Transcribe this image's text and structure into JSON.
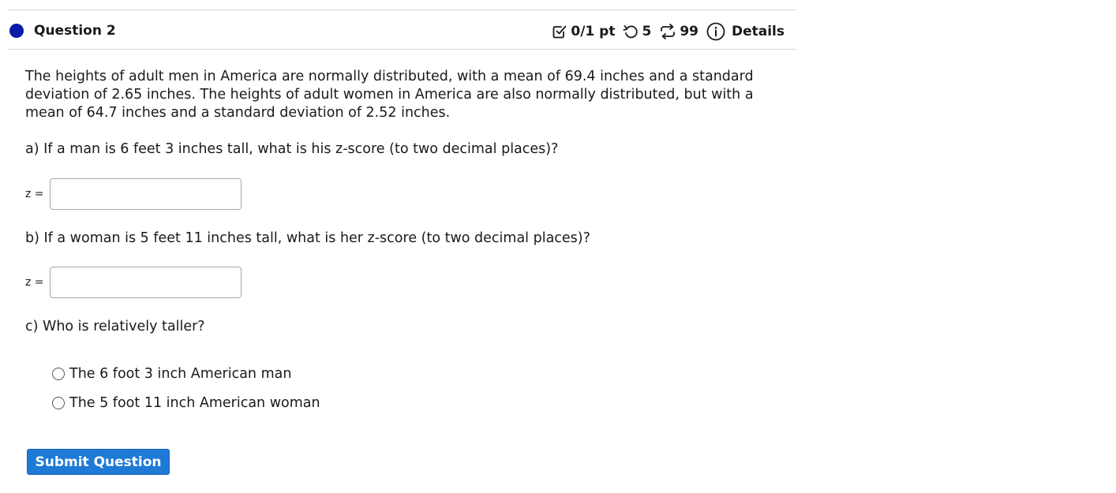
{
  "header": {
    "question_title": "Question 2",
    "score": "0/1 pt",
    "retries": "5",
    "attempts": "99",
    "details_label": "Details",
    "status_color": "#0a1aa8"
  },
  "question": {
    "intro": "The heights of adult men in America are normally distributed, with a mean of 69.4 inches and a standard deviation of 2.65 inches. The heights of adult women in America are also normally distributed, but with a mean of 64.7 inches and a standard deviation of 2.52 inches.",
    "part_a": "a) If a man is 6 feet 3 inches tall, what is his z-score (to two decimal places)?",
    "part_b": "b) If a woman is 5 feet 11 inches tall, what is her z-score (to two decimal places)?",
    "part_c": "c) Who is relatively taller?",
    "z_label_a": "z =",
    "z_label_b": "z =",
    "z_value_a": "",
    "z_value_b": "",
    "options": [
      "The 6 foot 3 inch American man",
      "The 5 foot 11 inch American woman"
    ]
  },
  "actions": {
    "submit_label": "Submit Question",
    "submit_color": "#1f7ad6"
  }
}
